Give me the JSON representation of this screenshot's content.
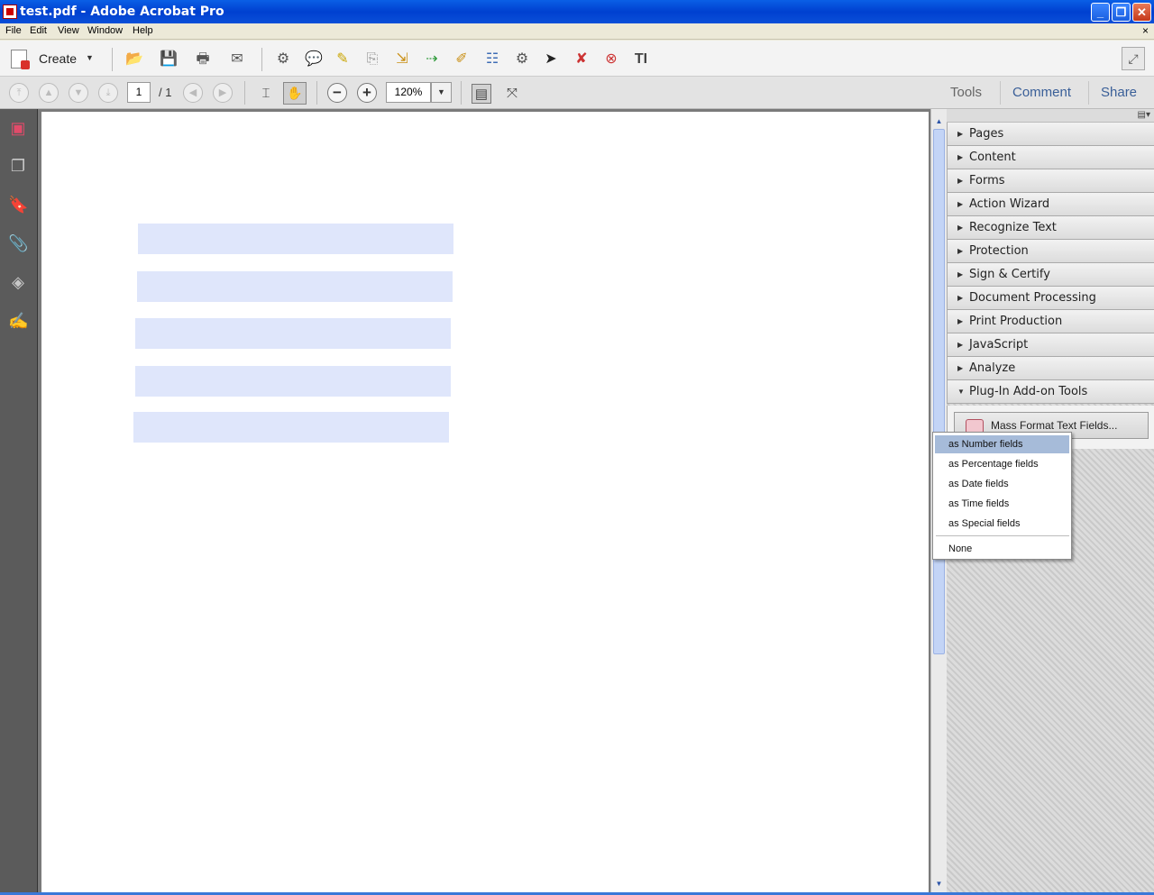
{
  "window": {
    "title": "test.pdf - Adobe Acrobat Pro",
    "minimize": "_",
    "restore": "❐",
    "close": "✕"
  },
  "menubar": {
    "items": [
      "File",
      "Edit",
      "View",
      "Window",
      "Help"
    ],
    "close_doc": "×"
  },
  "toolbar": {
    "create_label": "Create",
    "create_caret": "▼",
    "expand_glyph": "⤢",
    "icons": [
      "open-icon",
      "save-icon",
      "print-icon",
      "email-icon",
      "settings-icon",
      "comment-icon",
      "highlight-icon",
      "attach-icon",
      "export-icon",
      "combine-icon",
      "edit-icon",
      "forms-icon",
      "settings2-icon",
      "select-icon",
      "redact-icon",
      "spellcheck-icon",
      "text-tool-icon"
    ],
    "text_tool_glyph": "TI"
  },
  "nav": {
    "page_current": "1",
    "page_total": "/  1",
    "zoom_value": "120%",
    "zoom_caret": "▼",
    "zoom_out": "−",
    "zoom_in": "+"
  },
  "pane_tabs": {
    "tools": "Tools",
    "comment": "Comment",
    "share": "Share"
  },
  "tools_panels": [
    {
      "label": "Pages",
      "expanded": false
    },
    {
      "label": "Content",
      "expanded": false
    },
    {
      "label": "Forms",
      "expanded": false
    },
    {
      "label": "Action Wizard",
      "expanded": false
    },
    {
      "label": "Recognize Text",
      "expanded": false
    },
    {
      "label": "Protection",
      "expanded": false
    },
    {
      "label": "Sign & Certify",
      "expanded": false
    },
    {
      "label": "Document Processing",
      "expanded": false
    },
    {
      "label": "Print Production",
      "expanded": false
    },
    {
      "label": "JavaScript",
      "expanded": false
    },
    {
      "label": "Analyze",
      "expanded": false
    },
    {
      "label": "Plug-In Add-on Tools",
      "expanded": true
    }
  ],
  "plugin": {
    "mass_format_label": "Mass Format Text Fields..."
  },
  "context_menu": {
    "items": [
      {
        "label": "as Number fields",
        "highlighted": true
      },
      {
        "label": "as Percentage fields",
        "highlighted": false
      },
      {
        "label": "as Date fields",
        "highlighted": false
      },
      {
        "label": "as Time fields",
        "highlighted": false
      },
      {
        "label": "as Special fields",
        "highlighted": false
      }
    ],
    "none_label": "None"
  },
  "colors": {
    "title_bar": "#0a5fe6",
    "field_fill": "#dfe6fb",
    "menu_highlight": "#a6bbd9",
    "pane_tab_link": "#3a5f98"
  }
}
